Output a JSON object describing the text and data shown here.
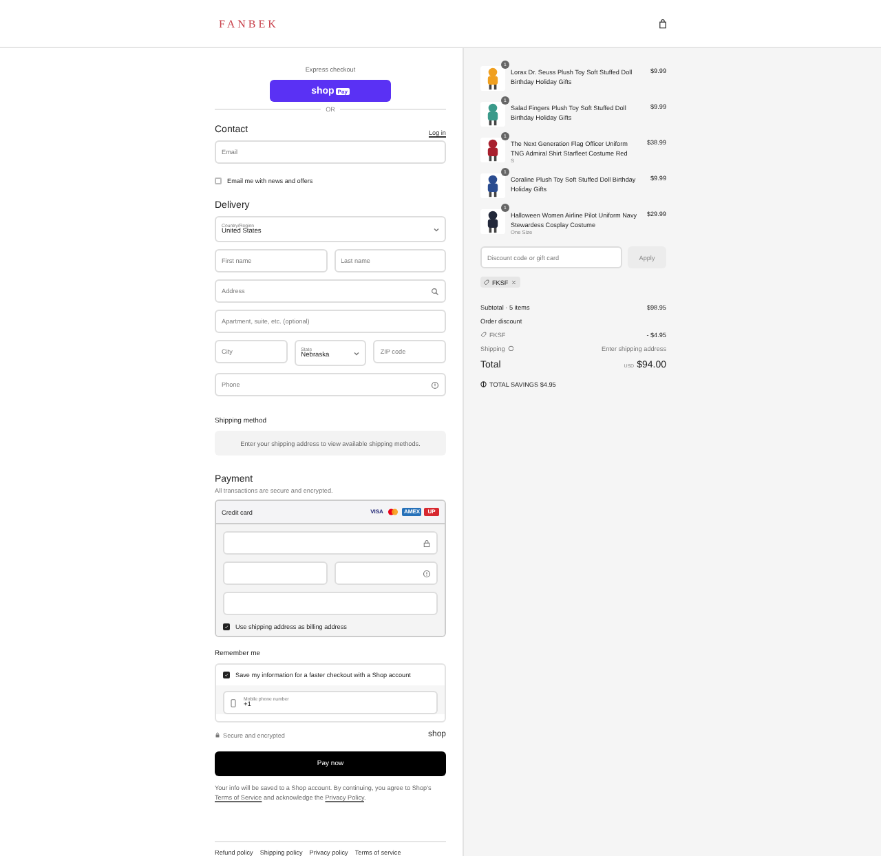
{
  "header": {
    "logo": "FANBEK"
  },
  "express": {
    "title": "Express checkout",
    "button": "shop",
    "button_badge": "Pay",
    "divider": "OR"
  },
  "contact": {
    "title": "Contact",
    "login": "Log in",
    "email_placeholder": "Email",
    "news": {
      "label": "Email me with news and offers",
      "checked": false
    }
  },
  "delivery": {
    "title": "Delivery",
    "country": {
      "label": "Country/Region",
      "value": "United States"
    },
    "first_name": {
      "placeholder": "First name"
    },
    "last_name": {
      "placeholder": "Last name"
    },
    "address": {
      "placeholder": "Address"
    },
    "apartment": {
      "placeholder": "Apartment, suite, etc. (optional)"
    },
    "city": {
      "placeholder": "City"
    },
    "state": {
      "label": "State",
      "value": "Nebraska"
    },
    "zip": {
      "placeholder": "ZIP code"
    },
    "phone": {
      "placeholder": "Phone"
    }
  },
  "shipping_method": {
    "title": "Shipping method",
    "message": "Enter your shipping address to view available shipping methods."
  },
  "payment": {
    "title": "Payment",
    "subtitle": "All transactions are secure and encrypted.",
    "method": "Credit card",
    "card_brands": [
      {
        "kind": "text",
        "label": "VISA"
      },
      {
        "kind": "mastercard"
      },
      {
        "kind": "text",
        "label": "AMEX"
      },
      {
        "kind": "text",
        "label": "UP"
      }
    ],
    "billing": {
      "label": "Use shipping address as billing address",
      "checked": true
    }
  },
  "remember": {
    "title": "Remember me",
    "save": {
      "label": "Save my information for a faster checkout with a Shop account",
      "checked": true
    },
    "mobile": {
      "label": "Mobile phone number",
      "value": "+1"
    },
    "secure": "Secure and encrypted",
    "brand": "shop"
  },
  "pay_button": "Pay now",
  "legal": {
    "text": "Your info will be saved to a Shop account. By continuing, you agree to Shop's",
    "terms": "Terms of Service",
    "middle": "and acknowledge the",
    "privacy": "Privacy Policy",
    "end": "."
  },
  "footer_links": [
    "Refund policy",
    "Shipping policy",
    "Privacy policy",
    "Terms of service"
  ],
  "cart": {
    "items": [
      {
        "name": "Lorax Dr. Seuss Plush Toy Soft Stuffed Doll Birthday Holiday Gifts",
        "price": "$9.99",
        "quantity": "1"
      },
      {
        "name": "Salad Fingers Plush Toy Soft Stuffed Doll Birthday Holiday Gifts",
        "price": "$9.99",
        "quantity": "1"
      },
      {
        "name": "The Next Generation Flag Officer Uniform TNG Admiral Shirt Starfleet Costume Red",
        "price": "$38.99",
        "quantity": "1",
        "variant": "S"
      },
      {
        "name": "Coraline Plush Toy Soft Stuffed Doll Birthday Holiday Gifts",
        "price": "$9.99",
        "quantity": "1"
      },
      {
        "name": "Halloween Women Airline Pilot Uniform Navy Stewardess Cosplay Costume",
        "price": "$29.99",
        "quantity": "1",
        "variant": "One Size"
      }
    ],
    "discount_placeholder": "Discount code or gift card",
    "apply": "Apply",
    "code_tag": "FKSF",
    "subtotal_label": "Subtotal · 5 items",
    "subtotal": "$98.95",
    "order_discount": "Order discount",
    "discount_code": "FKSF",
    "discount_amount": "- $4.95",
    "shipping_label": "Shipping",
    "shipping_value": "Enter shipping address",
    "total_label": "Total",
    "currency": "USD",
    "total": "$94.00",
    "savings": "TOTAL SAVINGS $4.95"
  }
}
